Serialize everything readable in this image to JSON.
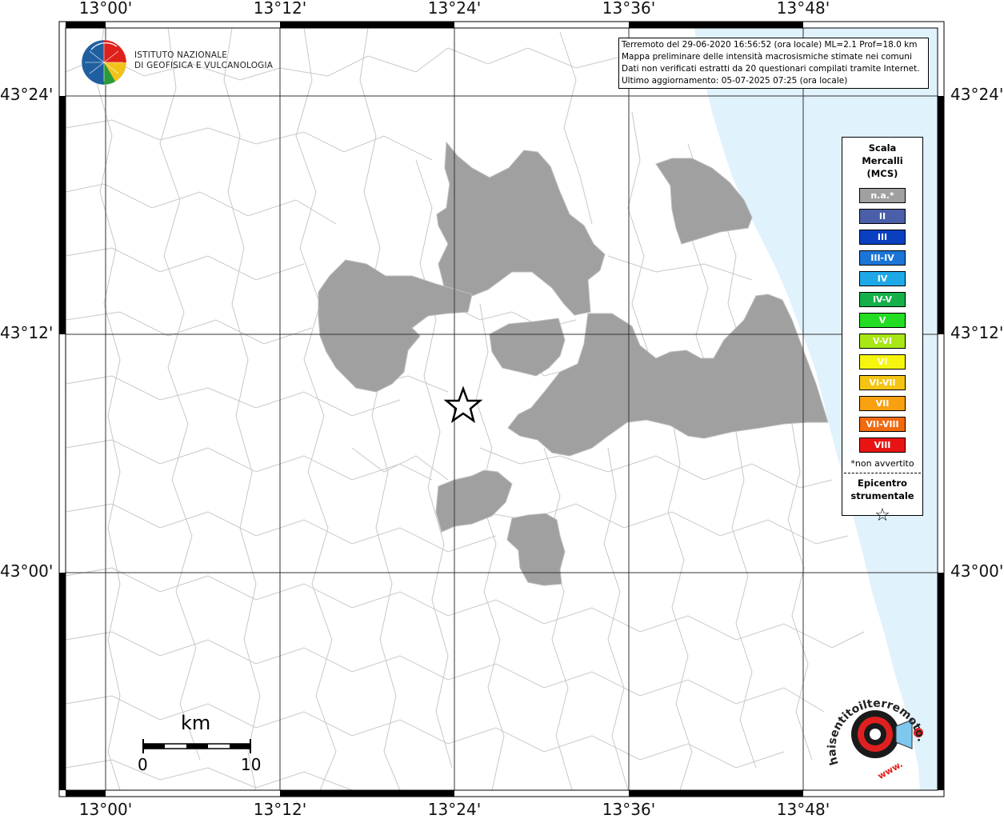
{
  "map": {
    "top_ticks": [
      "13°00'",
      "13°12'",
      "13°24'",
      "13°36'",
      "13°48'"
    ],
    "bottom_ticks": [
      "13°00'",
      "13°12'",
      "13°24'",
      "13°36'",
      "13°48'"
    ],
    "left_ticks": [
      "43°24'",
      "43°12'",
      "43°00'"
    ],
    "right_ticks": [
      "43°24'",
      "43°12'",
      "43°00'"
    ],
    "colors": {
      "not_felt": "#a0a0a0",
      "sea": "#e0f2fb",
      "border": "#cccccc",
      "grid": "#444444"
    }
  },
  "info_box": {
    "line1": "Terremoto del 29-06-2020 16:56:52 (ora locale) ML=2.1 Prof=18.0 km",
    "line2": "Mappa preliminare delle intensità macrosismiche stimate nei comuni",
    "line3": "Dati non verificati estratti da 20 questionari compilati tramite Internet.",
    "line4": "Ultimo aggiornamento: 05-07-2025 07:25 (ora locale)"
  },
  "logo": {
    "line1": "ISTITUTO NAZIONALE",
    "line2": "DI GEOFISICA E VULCANOLOGIA"
  },
  "legend": {
    "title1": "Scala",
    "title2": "Mercalli",
    "title3": "(MCS)",
    "items": [
      {
        "label": "n.a.*",
        "color": "#a0a0a0"
      },
      {
        "label": "II",
        "color": "#4a5fa8"
      },
      {
        "label": "III",
        "color": "#0a3fc0"
      },
      {
        "label": "III-IV",
        "color": "#1a75d6"
      },
      {
        "label": "IV",
        "color": "#1fa8e8"
      },
      {
        "label": "IV-V",
        "color": "#16b04a"
      },
      {
        "label": "V",
        "color": "#22dd22"
      },
      {
        "label": "V-VI",
        "color": "#a8e616"
      },
      {
        "label": "VI",
        "color": "#f5f510"
      },
      {
        "label": "VI-VII",
        "color": "#f4c414"
      },
      {
        "label": "VII",
        "color": "#f8a010"
      },
      {
        "label": "VII-VIII",
        "color": "#f06a10"
      },
      {
        "label": "VIII",
        "color": "#e81414"
      }
    ],
    "note": "*non avvertito",
    "epicenter1": "Epicentro",
    "epicenter2": "strumentale",
    "star": "☆"
  },
  "scalebar": {
    "unit": "km",
    "min": "0",
    "max": "10"
  },
  "watermark": {
    "text": "haisentitoilterremoto.it",
    "www": "www."
  }
}
